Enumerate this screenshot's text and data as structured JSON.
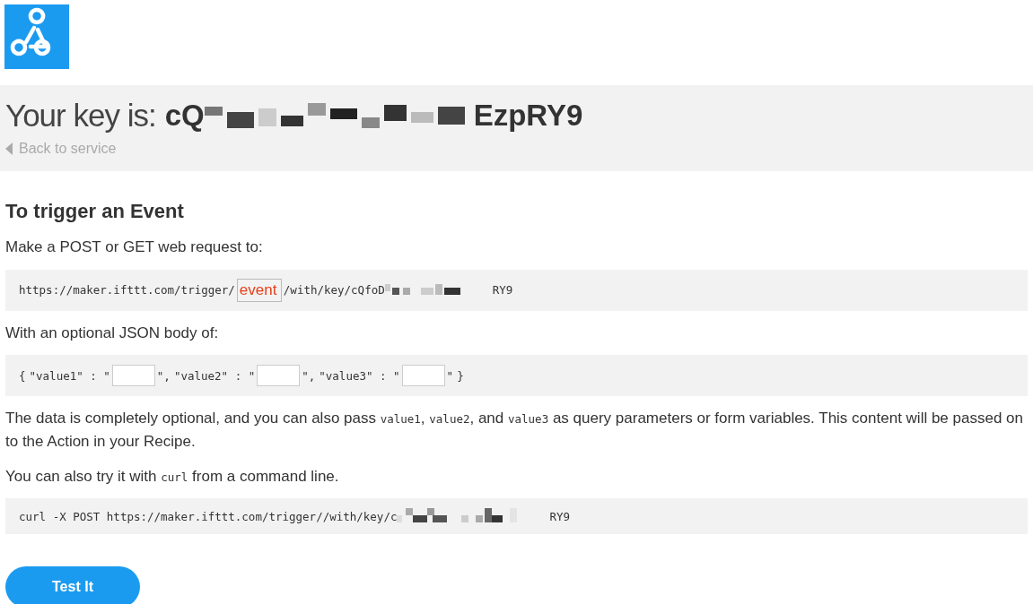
{
  "header": {
    "key_label": "Your key is:",
    "key_start": "cQ",
    "key_end": "EzpRY9",
    "back_link": "Back to service"
  },
  "section": {
    "heading": "To trigger an Event",
    "request_intro": "Make a POST or GET web request to:",
    "url": {
      "prefix": "https://maker.ifttt.com/trigger/",
      "event_value": "event",
      "middle": "/with/key/cQfoD",
      "suffix": "RY9"
    },
    "body_intro": "With an optional JSON body of:",
    "body": {
      "open": "{",
      "fields": [
        {
          "name": "\"value1\" : \"",
          "close": "\","
        },
        {
          "name": "\"value2\" : \"",
          "close": "\","
        },
        {
          "name": "\"value3\" : \"",
          "close": "\""
        }
      ],
      "end": "}"
    },
    "note_parts": [
      "The data is completely optional, and you can also pass ",
      "value1",
      ", ",
      "value2",
      ", and ",
      "value3",
      " as query parameters or form variables. This content will be passed on to the Action in your Recipe."
    ],
    "curl_parts": [
      "You can also try it with ",
      "curl",
      " from a command line."
    ],
    "curl": {
      "prefix": "curl -X POST https://maker.ifttt.com/trigger//with/key/c",
      "suffix": "RY9"
    },
    "button": "Test It"
  }
}
